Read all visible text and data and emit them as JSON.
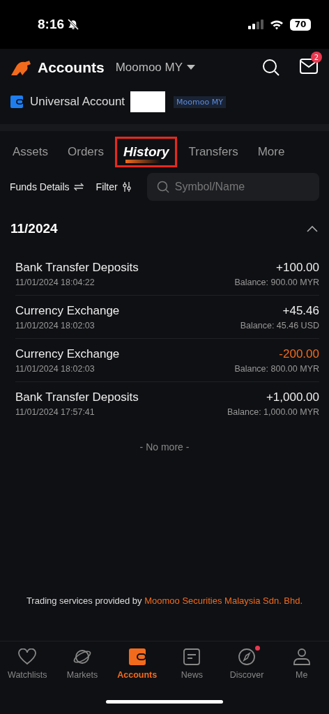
{
  "status_bar": {
    "time": "8:16",
    "battery": "70"
  },
  "header": {
    "title": "Accounts",
    "account_switch": "Moomoo MY",
    "notifications": "2"
  },
  "account": {
    "name": "Universal Account",
    "tag": "Moomoo MY"
  },
  "tabs": [
    {
      "label": "Assets",
      "selected": false,
      "highlighted": false
    },
    {
      "label": "Orders",
      "selected": false,
      "highlighted": false
    },
    {
      "label": "History",
      "selected": true,
      "highlighted": true
    },
    {
      "label": "Transfers",
      "selected": false,
      "highlighted": false
    },
    {
      "label": "More",
      "selected": false,
      "highlighted": false
    }
  ],
  "toolbar": {
    "funds": "Funds Details",
    "filter": "Filter",
    "search": {
      "placeholder": "Symbol/Name"
    }
  },
  "month": {
    "label": "11/2024",
    "expanded": true
  },
  "transactions": [
    {
      "title": "Bank Transfer Deposits",
      "time": "11/01/2024 18:04:22",
      "amount": "+100.00",
      "negative": false,
      "balance": "Balance: 900.00 MYR"
    },
    {
      "title": "Currency Exchange",
      "time": "11/01/2024 18:02:03",
      "amount": "+45.46",
      "negative": false,
      "balance": "Balance: 45.46 USD"
    },
    {
      "title": "Currency Exchange",
      "time": "11/01/2024 18:02:03",
      "amount": "-200.00",
      "negative": true,
      "balance": "Balance: 800.00 MYR"
    },
    {
      "title": "Bank Transfer Deposits",
      "time": "11/01/2024 17:57:41",
      "amount": "+1,000.00",
      "negative": false,
      "balance": "Balance: 1,000.00 MYR"
    }
  ],
  "end_note": "- No more -",
  "footer": {
    "text": "Trading services provided by ",
    "link": "Moomoo Securities Malaysia Sdn. Bhd."
  },
  "nav": [
    {
      "label": "Watchlists",
      "selected": false,
      "dot": false
    },
    {
      "label": "Markets",
      "selected": false,
      "dot": false
    },
    {
      "label": "Accounts",
      "selected": true,
      "dot": false
    },
    {
      "label": "News",
      "selected": false,
      "dot": false
    },
    {
      "label": "Discover",
      "selected": false,
      "dot": true
    },
    {
      "label": "Me",
      "selected": false,
      "dot": false
    }
  ]
}
